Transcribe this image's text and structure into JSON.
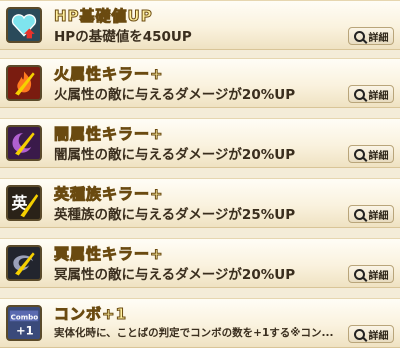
{
  "detail_label": "詳細",
  "abilities": [
    {
      "icon": "heart-hp-up-icon",
      "title": "HP基礎値UP",
      "desc": "HPの基礎値を450UP"
    },
    {
      "icon": "fire-killer-icon",
      "title": "火属性キラー+",
      "desc": "火属性の敵に与えるダメージが20%UP"
    },
    {
      "icon": "darkness-killer-icon",
      "title": "闇属性キラー+",
      "desc": "闇属性の敵に与えるダメージが20%UP"
    },
    {
      "icon": "hero-race-killer-icon",
      "title": "英種族キラー+",
      "desc": "英種族の敵に与えるダメージが25%UP"
    },
    {
      "icon": "underworld-killer-icon",
      "title": "冥属性キラー+",
      "desc": "冥属性の敵に与えるダメージが20%UP"
    },
    {
      "icon": "combo-plus-one-icon",
      "title": "コンボ+1",
      "desc": "実体化時に、ことばの判定でコンボの数を+1する※コン..."
    }
  ],
  "icon_text": {
    "hero": "英",
    "combo": "Combo",
    "plus": "+1"
  }
}
